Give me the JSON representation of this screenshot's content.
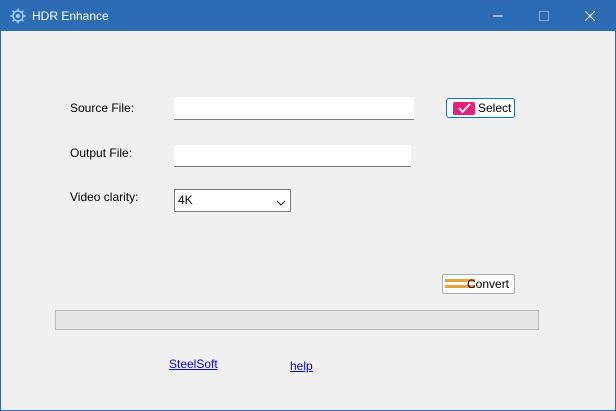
{
  "window": {
    "title": "HDR Enhance"
  },
  "form": {
    "source_label": "Source File:",
    "source_value": "",
    "output_label": "Output File:",
    "output_value": "",
    "clarity_label": "Video clarity:",
    "clarity_selected": "4K"
  },
  "buttons": {
    "select_label": "Select",
    "select_icon": "check-icon",
    "convert_label": "Convert",
    "convert_icon": "stripes-icon"
  },
  "progress": {
    "value": 0
  },
  "links": {
    "steelsoft": "SteelSoft",
    "help": "help"
  },
  "colors": {
    "titlebar": "#2b6cb3",
    "select_accent": "#e8207b",
    "convert_accent": "#e8a33a"
  }
}
